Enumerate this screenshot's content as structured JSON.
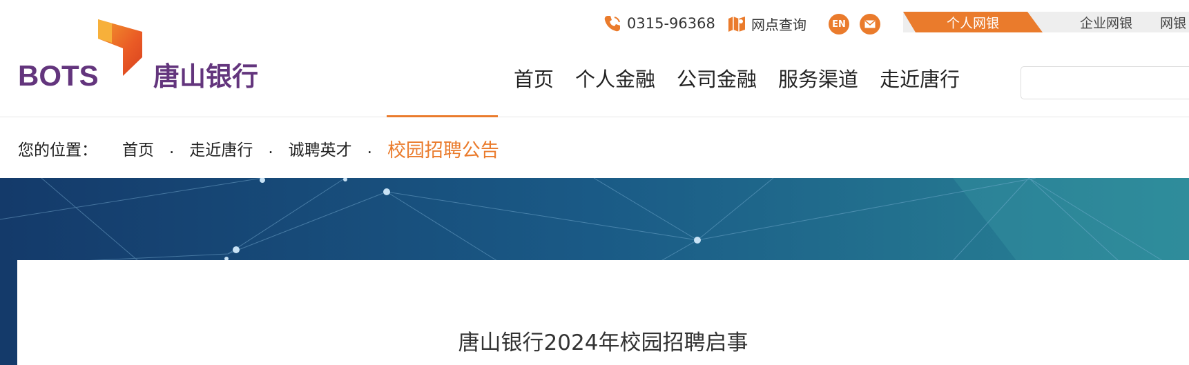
{
  "brand": {
    "logo_text": "BOTS",
    "bank_name": "唐山银行",
    "colors": {
      "accent": "#ea7b2c",
      "purple": "#63357d",
      "banner_dark": "#143a6a",
      "banner_mid": "#1f6f93"
    }
  },
  "utility": {
    "phone_icon": "phone-icon",
    "phone": "0315-96368",
    "map_icon": "map-icon",
    "outlet_search": "网点查询",
    "en_label": "EN",
    "mail_icon": "mail-icon"
  },
  "tabs": {
    "personal": "个人网银",
    "corporate": "企业网银",
    "more": "网银"
  },
  "nav": {
    "items": [
      "首页",
      "个人金融",
      "公司金融",
      "服务渠道",
      "走近唐行"
    ]
  },
  "breadcrumb": {
    "label": "您的位置：",
    "items": [
      "首页",
      "走近唐行",
      "诚聘英才"
    ],
    "separator": ".",
    "current": "校园招聘公告"
  },
  "article": {
    "title": "唐山银行2024年校园招聘启事"
  }
}
